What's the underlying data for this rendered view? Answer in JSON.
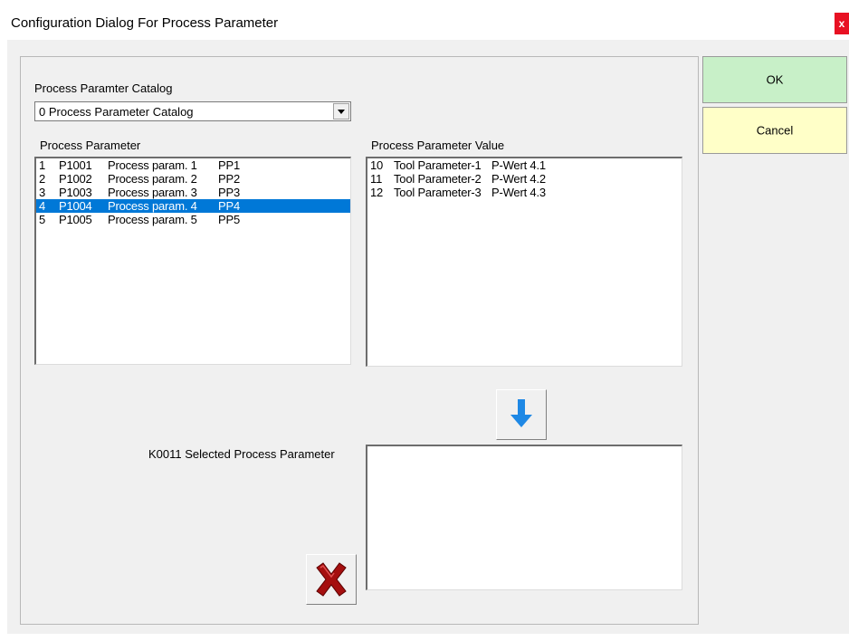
{
  "window": {
    "title": "Configuration Dialog For Process Parameter",
    "close_glyph": "x"
  },
  "catalog": {
    "label": "Process Paramter Catalog",
    "selected": "0  Process Parameter Catalog"
  },
  "process_parameter": {
    "label": "Process Parameter",
    "items": [
      {
        "no": "1",
        "code": "P1001",
        "name": "Process param. 1",
        "short": "PP1",
        "selected": false
      },
      {
        "no": "2",
        "code": "P1002",
        "name": "Process param. 2",
        "short": "PP2",
        "selected": false
      },
      {
        "no": "3",
        "code": "P1003",
        "name": "Process param. 3",
        "short": "PP3",
        "selected": false
      },
      {
        "no": "4",
        "code": "P1004",
        "name": "Process param. 4",
        "short": "PP4",
        "selected": true
      },
      {
        "no": "5",
        "code": "P1005",
        "name": "Process param. 5",
        "short": "PP5",
        "selected": false
      }
    ]
  },
  "process_parameter_value": {
    "label": "Process Parameter Value",
    "items": [
      {
        "no": "10",
        "name": "Tool Parameter-1",
        "value": "P-Wert 4.1"
      },
      {
        "no": "11",
        "name": "Tool Parameter-2",
        "value": "P-Wert 4.2"
      },
      {
        "no": "12",
        "name": "Tool Parameter-3",
        "value": "P-Wert 4.3"
      }
    ]
  },
  "selected_parameter": {
    "label": "K0011 Selected Process Parameter",
    "items": []
  },
  "buttons": {
    "ok_label": "OK",
    "cancel_label": "Cancel"
  },
  "icons": {
    "add": "arrow-down-icon",
    "remove": "red-x-icon"
  },
  "colors": {
    "selection": "#0078d7",
    "ok_bg": "#c8f0c8",
    "cancel_bg": "#ffffc8",
    "arrow": "#1e88e5",
    "delete": "#a50f0f"
  }
}
